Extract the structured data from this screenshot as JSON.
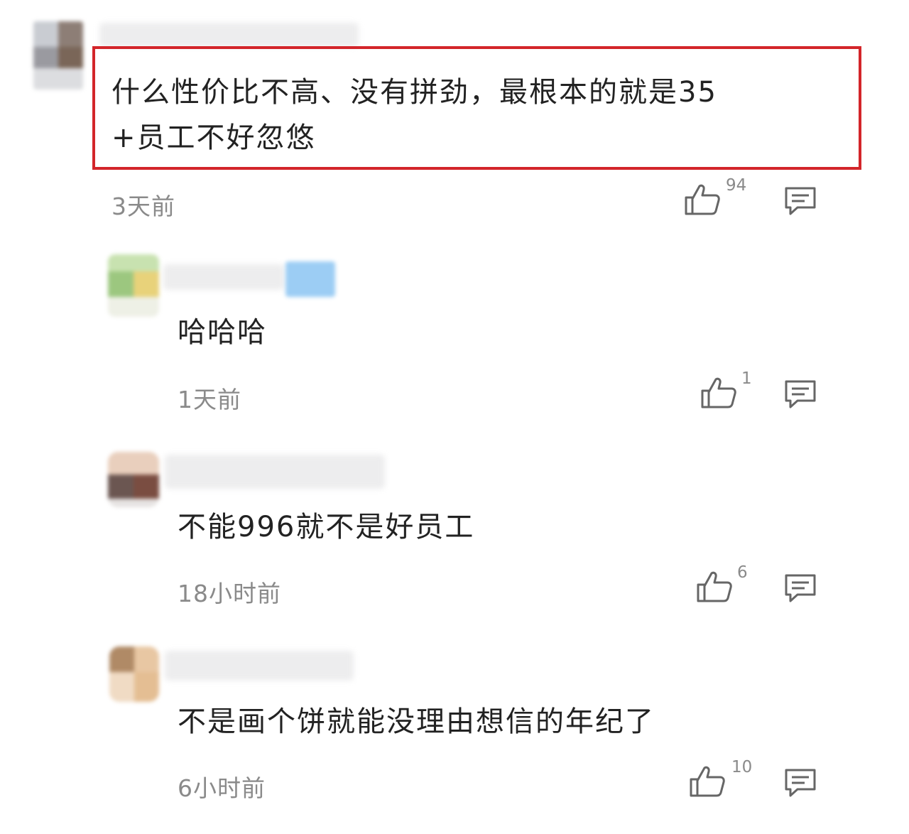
{
  "comments": [
    {
      "text_line1": "什么性价比不高、没有拼劲，最根本的就是35",
      "text_line2": "+员工不好忽悠",
      "time": "3天前",
      "likes": "94",
      "highlighted": true
    },
    {
      "text_line1": "哈哈哈",
      "time": "1天前",
      "likes": "1"
    },
    {
      "text_line1": "不能996就不是好员工",
      "time": "18小时前",
      "likes": "6"
    },
    {
      "text_line1": "不是画个饼就能没理由想信的年纪了",
      "time": "6小时前",
      "likes": "10"
    }
  ],
  "icons": {
    "like": "thumbs-up-icon",
    "reply": "comment-bubble-icon"
  },
  "colors": {
    "highlight_border": "#d3252a",
    "text": "#222222",
    "meta": "#8a8a8a"
  }
}
